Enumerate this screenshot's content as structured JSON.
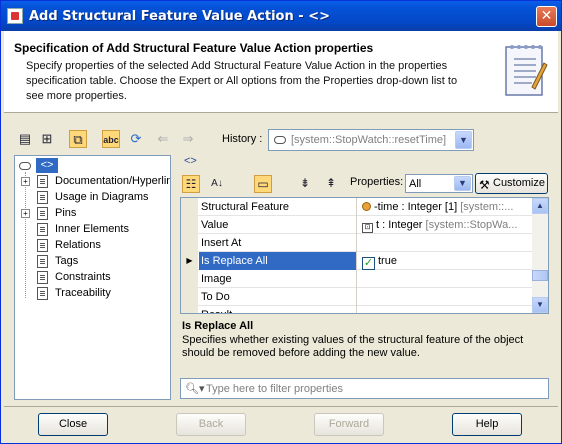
{
  "window": {
    "title": "Add Structural Feature Value Action - <>",
    "close_symbol": "✕"
  },
  "header": {
    "title": "Specification of Add Structural Feature Value Action properties",
    "description": "Specify properties of the selected Add Structural Feature Value Action in the properties specification table. Choose the Expert or All options from the Properties drop-down list to see more properties."
  },
  "history": {
    "label": "History :",
    "value": "[system::StopWatch::resetTime]"
  },
  "tree": {
    "root": "<>",
    "items": [
      {
        "label": "Documentation/Hyperlin",
        "expandable": true
      },
      {
        "label": "Usage in Diagrams",
        "expandable": false
      },
      {
        "label": "Pins",
        "expandable": true
      },
      {
        "label": "Inner Elements",
        "expandable": false
      },
      {
        "label": "Relations",
        "expandable": false
      },
      {
        "label": "Tags",
        "expandable": false
      },
      {
        "label": "Constraints",
        "expandable": false
      },
      {
        "label": "Traceability",
        "expandable": false
      }
    ]
  },
  "right": {
    "element_label": "<>",
    "properties_label": "Properties:",
    "properties_value": "All",
    "customize_label": "Customize"
  },
  "grid": {
    "rows": [
      {
        "name": "Structural Feature",
        "value": "-time : Integer [1] ",
        "muted": "[system::...",
        "icon": "feature-icon"
      },
      {
        "name": "Value",
        "value": "t : Integer ",
        "muted": "[system::StopWa...",
        "icon": "pin-icon"
      },
      {
        "name": "Insert At",
        "value": "",
        "muted": ""
      },
      {
        "name": "Is Replace All",
        "value": "true",
        "muted": "",
        "checkbox": true,
        "selected": true
      },
      {
        "name": "Image",
        "value": "",
        "muted": ""
      },
      {
        "name": "To Do",
        "value": "",
        "muted": ""
      },
      {
        "name": "Result",
        "value": "",
        "muted": ""
      }
    ]
  },
  "description": {
    "title": "Is Replace All",
    "text": "Specifies whether existing values of the structural feature of the object should be removed before adding the new value."
  },
  "filter": {
    "placeholder": "Type here to filter properties"
  },
  "buttons": {
    "close": "Close",
    "back": "Back",
    "forward": "Forward",
    "help": "Help"
  },
  "colors": {
    "title_bar": "#0553d8",
    "selection": "#316ac5",
    "dialog_bg": "#ece9d8"
  }
}
